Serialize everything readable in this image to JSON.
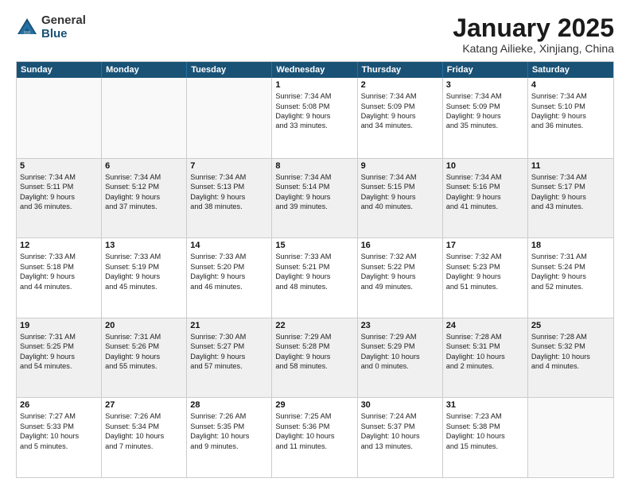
{
  "logo": {
    "general": "General",
    "blue": "Blue"
  },
  "header": {
    "title": "January 2025",
    "subtitle": "Katang Ailieke, Xinjiang, China"
  },
  "days": [
    "Sunday",
    "Monday",
    "Tuesday",
    "Wednesday",
    "Thursday",
    "Friday",
    "Saturday"
  ],
  "weeks": [
    [
      {
        "day": "",
        "empty": true
      },
      {
        "day": "",
        "empty": true
      },
      {
        "day": "",
        "empty": true
      },
      {
        "day": "1",
        "lines": [
          "Sunrise: 7:34 AM",
          "Sunset: 5:08 PM",
          "Daylight: 9 hours",
          "and 33 minutes."
        ]
      },
      {
        "day": "2",
        "lines": [
          "Sunrise: 7:34 AM",
          "Sunset: 5:09 PM",
          "Daylight: 9 hours",
          "and 34 minutes."
        ]
      },
      {
        "day": "3",
        "lines": [
          "Sunrise: 7:34 AM",
          "Sunset: 5:09 PM",
          "Daylight: 9 hours",
          "and 35 minutes."
        ]
      },
      {
        "day": "4",
        "lines": [
          "Sunrise: 7:34 AM",
          "Sunset: 5:10 PM",
          "Daylight: 9 hours",
          "and 36 minutes."
        ]
      }
    ],
    [
      {
        "day": "5",
        "lines": [
          "Sunrise: 7:34 AM",
          "Sunset: 5:11 PM",
          "Daylight: 9 hours",
          "and 36 minutes."
        ],
        "shaded": true
      },
      {
        "day": "6",
        "lines": [
          "Sunrise: 7:34 AM",
          "Sunset: 5:12 PM",
          "Daylight: 9 hours",
          "and 37 minutes."
        ],
        "shaded": true
      },
      {
        "day": "7",
        "lines": [
          "Sunrise: 7:34 AM",
          "Sunset: 5:13 PM",
          "Daylight: 9 hours",
          "and 38 minutes."
        ],
        "shaded": true
      },
      {
        "day": "8",
        "lines": [
          "Sunrise: 7:34 AM",
          "Sunset: 5:14 PM",
          "Daylight: 9 hours",
          "and 39 minutes."
        ],
        "shaded": true
      },
      {
        "day": "9",
        "lines": [
          "Sunrise: 7:34 AM",
          "Sunset: 5:15 PM",
          "Daylight: 9 hours",
          "and 40 minutes."
        ],
        "shaded": true
      },
      {
        "day": "10",
        "lines": [
          "Sunrise: 7:34 AM",
          "Sunset: 5:16 PM",
          "Daylight: 9 hours",
          "and 41 minutes."
        ],
        "shaded": true
      },
      {
        "day": "11",
        "lines": [
          "Sunrise: 7:34 AM",
          "Sunset: 5:17 PM",
          "Daylight: 9 hours",
          "and 43 minutes."
        ],
        "shaded": true
      }
    ],
    [
      {
        "day": "12",
        "lines": [
          "Sunrise: 7:33 AM",
          "Sunset: 5:18 PM",
          "Daylight: 9 hours",
          "and 44 minutes."
        ]
      },
      {
        "day": "13",
        "lines": [
          "Sunrise: 7:33 AM",
          "Sunset: 5:19 PM",
          "Daylight: 9 hours",
          "and 45 minutes."
        ]
      },
      {
        "day": "14",
        "lines": [
          "Sunrise: 7:33 AM",
          "Sunset: 5:20 PM",
          "Daylight: 9 hours",
          "and 46 minutes."
        ]
      },
      {
        "day": "15",
        "lines": [
          "Sunrise: 7:33 AM",
          "Sunset: 5:21 PM",
          "Daylight: 9 hours",
          "and 48 minutes."
        ]
      },
      {
        "day": "16",
        "lines": [
          "Sunrise: 7:32 AM",
          "Sunset: 5:22 PM",
          "Daylight: 9 hours",
          "and 49 minutes."
        ]
      },
      {
        "day": "17",
        "lines": [
          "Sunrise: 7:32 AM",
          "Sunset: 5:23 PM",
          "Daylight: 9 hours",
          "and 51 minutes."
        ]
      },
      {
        "day": "18",
        "lines": [
          "Sunrise: 7:31 AM",
          "Sunset: 5:24 PM",
          "Daylight: 9 hours",
          "and 52 minutes."
        ]
      }
    ],
    [
      {
        "day": "19",
        "lines": [
          "Sunrise: 7:31 AM",
          "Sunset: 5:25 PM",
          "Daylight: 9 hours",
          "and 54 minutes."
        ],
        "shaded": true
      },
      {
        "day": "20",
        "lines": [
          "Sunrise: 7:31 AM",
          "Sunset: 5:26 PM",
          "Daylight: 9 hours",
          "and 55 minutes."
        ],
        "shaded": true
      },
      {
        "day": "21",
        "lines": [
          "Sunrise: 7:30 AM",
          "Sunset: 5:27 PM",
          "Daylight: 9 hours",
          "and 57 minutes."
        ],
        "shaded": true
      },
      {
        "day": "22",
        "lines": [
          "Sunrise: 7:29 AM",
          "Sunset: 5:28 PM",
          "Daylight: 9 hours",
          "and 58 minutes."
        ],
        "shaded": true
      },
      {
        "day": "23",
        "lines": [
          "Sunrise: 7:29 AM",
          "Sunset: 5:29 PM",
          "Daylight: 10 hours",
          "and 0 minutes."
        ],
        "shaded": true
      },
      {
        "day": "24",
        "lines": [
          "Sunrise: 7:28 AM",
          "Sunset: 5:31 PM",
          "Daylight: 10 hours",
          "and 2 minutes."
        ],
        "shaded": true
      },
      {
        "day": "25",
        "lines": [
          "Sunrise: 7:28 AM",
          "Sunset: 5:32 PM",
          "Daylight: 10 hours",
          "and 4 minutes."
        ],
        "shaded": true
      }
    ],
    [
      {
        "day": "26",
        "lines": [
          "Sunrise: 7:27 AM",
          "Sunset: 5:33 PM",
          "Daylight: 10 hours",
          "and 5 minutes."
        ]
      },
      {
        "day": "27",
        "lines": [
          "Sunrise: 7:26 AM",
          "Sunset: 5:34 PM",
          "Daylight: 10 hours",
          "and 7 minutes."
        ]
      },
      {
        "day": "28",
        "lines": [
          "Sunrise: 7:26 AM",
          "Sunset: 5:35 PM",
          "Daylight: 10 hours",
          "and 9 minutes."
        ]
      },
      {
        "day": "29",
        "lines": [
          "Sunrise: 7:25 AM",
          "Sunset: 5:36 PM",
          "Daylight: 10 hours",
          "and 11 minutes."
        ]
      },
      {
        "day": "30",
        "lines": [
          "Sunrise: 7:24 AM",
          "Sunset: 5:37 PM",
          "Daylight: 10 hours",
          "and 13 minutes."
        ]
      },
      {
        "day": "31",
        "lines": [
          "Sunrise: 7:23 AM",
          "Sunset: 5:38 PM",
          "Daylight: 10 hours",
          "and 15 minutes."
        ]
      },
      {
        "day": "",
        "empty": true
      }
    ]
  ]
}
